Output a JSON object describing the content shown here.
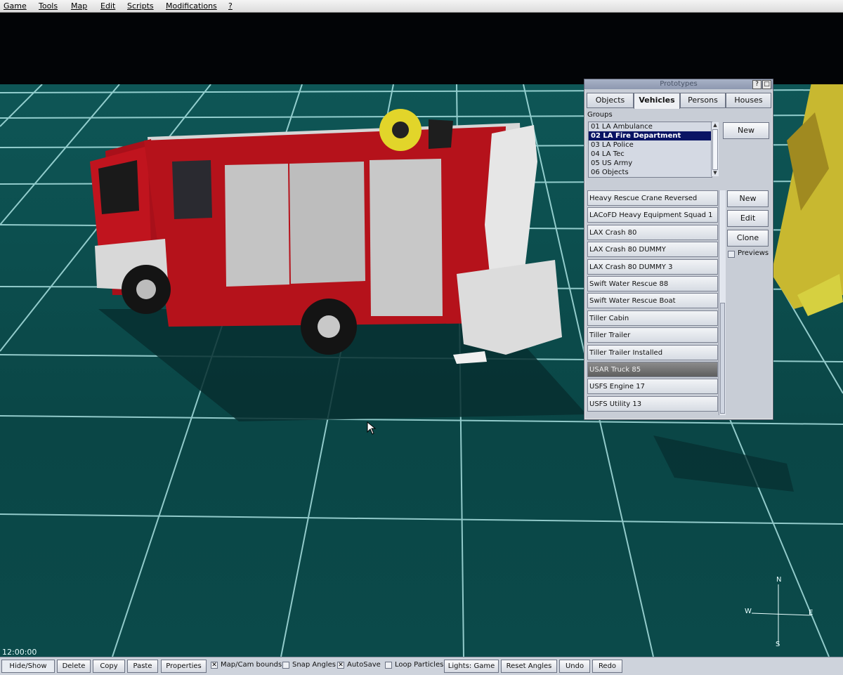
{
  "menu": [
    "Game",
    "Tools",
    "Map",
    "Edit",
    "Scripts",
    "Modifications",
    "?"
  ],
  "panel": {
    "title": "Prototypes",
    "title_buttons": [
      "?",
      "□"
    ],
    "tabs": [
      {
        "label": "Objects",
        "active": false
      },
      {
        "label": "Vehicles",
        "active": true
      },
      {
        "label": "Persons",
        "active": false
      },
      {
        "label": "Houses",
        "active": false
      }
    ],
    "groups_label": "Groups",
    "groups": [
      {
        "label": "01 LA Ambulance",
        "selected": false
      },
      {
        "label": "02 LA Fire Department",
        "selected": true
      },
      {
        "label": "03 LA Police",
        "selected": false
      },
      {
        "label": "04 LA Tec",
        "selected": false
      },
      {
        "label": "05 US Army",
        "selected": false
      },
      {
        "label": "06 Objects",
        "selected": false
      }
    ],
    "groups_new": "New",
    "vehicles": [
      {
        "label": "Heavy Rescue Crane Reversed",
        "selected": false
      },
      {
        "label": "LACoFD Heavy Equipment Squad 1",
        "selected": false
      },
      {
        "label": "LAX Crash 80",
        "selected": false
      },
      {
        "label": "LAX Crash 80 DUMMY",
        "selected": false
      },
      {
        "label": "LAX Crash 80 DUMMY 3",
        "selected": false
      },
      {
        "label": "Swift Water Rescue 88",
        "selected": false
      },
      {
        "label": "Swift Water Rescue Boat",
        "selected": false
      },
      {
        "label": "Tiller Cabin",
        "selected": false
      },
      {
        "label": "Tiller Trailer",
        "selected": false
      },
      {
        "label": "Tiller Trailer Installed",
        "selected": false
      },
      {
        "label": "USAR Truck 85",
        "selected": true
      },
      {
        "label": "USFS Engine 17",
        "selected": false
      },
      {
        "label": "USFS Utility 13",
        "selected": false
      }
    ],
    "buttons": {
      "new": "New",
      "edit": "Edit",
      "clone": "Clone"
    },
    "previews": {
      "label": "Previews",
      "checked": false
    }
  },
  "clock": "12:00:00",
  "statusbar": {
    "hide_show": "Hide/Show",
    "delete": "Delete",
    "copy": "Copy",
    "paste": "Paste",
    "properties": "Properties",
    "map_cam_bounds": {
      "label": "Map/Cam bounds",
      "checked": true
    },
    "snap_angles": {
      "label": "Snap Angles",
      "checked": false
    },
    "autosave": {
      "label": "AutoSave",
      "checked": true
    },
    "loop_particles": {
      "label": "Loop Particles",
      "checked": false
    },
    "lights": "Lights: Game",
    "reset_angles": "Reset Angles",
    "undo": "Undo",
    "redo": "Redo"
  },
  "compass": {
    "n": "N",
    "s": "S",
    "e": "E",
    "w": "W"
  },
  "colors": {
    "grid": "#bff6f6",
    "ground": "#0d4f4f",
    "truck_red": "#b5121b",
    "selection": "#0a1464"
  }
}
